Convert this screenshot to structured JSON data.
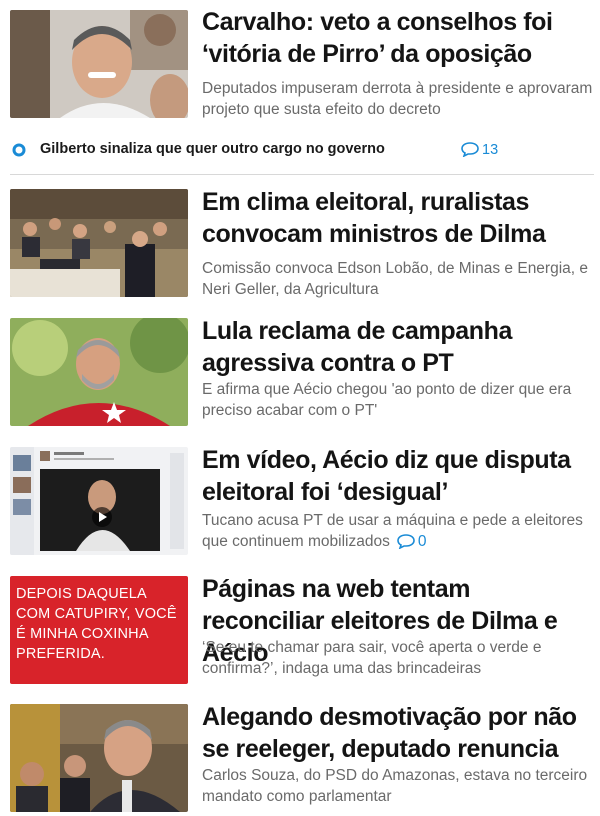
{
  "stories": [
    {
      "headline": "Carvalho: veto a conselhos foi ‘vitória de Pirro’ da oposição",
      "summary": "Deputados impuseram derrota à presidente e aprovaram projeto que susta efeito do decreto"
    },
    {
      "headline": "Em clima eleitoral, ruralistas convocam ministros de Dilma",
      "summary": "Comissão convoca Edson Lobão, de Minas e Energia, e Neri Geller, da Agricultura"
    },
    {
      "headline": "Lula reclama de campanha agressiva contra o PT",
      "summary": "E afirma que Aécio chegou 'ao ponto de dizer que era preciso acabar com o PT'"
    },
    {
      "headline": "Em vídeo, Aécio diz que disputa eleitoral foi ‘desigual’",
      "summary": "Tucano acusa PT de usar a máquina e pede a eleitores que continuem mobilizados",
      "comment_count": "0"
    },
    {
      "headline": "Páginas na web tentam reconciliar eleitores de Dilma e Aécio",
      "summary": "‘Se eu te chamar para sair, você aperta o verde e confirma?’, indaga uma das brincadeiras",
      "image_text": "DEPOIS DAQUELA COM CATUPIRY, VOCÊ É MINHA COXINHA PREFERIDA."
    },
    {
      "headline": "Alegando desmotivação por não se reeleger, deputado renuncia",
      "summary": "Carlos Souza, do PSD do Amazonas, estava no terceiro mandato como parlamentar"
    }
  ],
  "related": {
    "text": "Gilberto sinaliza que quer outro cargo no governo",
    "comment_count": "13"
  },
  "icons": {
    "related_bullet": "ring-bullet-icon",
    "comments": "speech-bubble-icon",
    "play": "play-icon"
  },
  "colors": {
    "accent_blue": "#1a8bd6",
    "card_red": "#d8232a",
    "headline": "#141414",
    "summary": "#6a6a6a"
  }
}
